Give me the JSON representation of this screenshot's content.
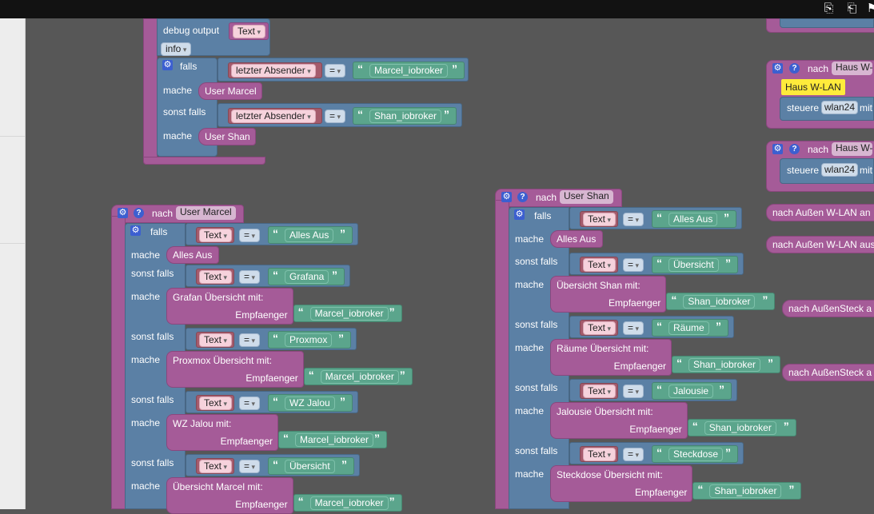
{
  "toolbar": {
    "icons": [
      "export-icon",
      "import-icon",
      "more-icon"
    ]
  },
  "top_block": {
    "debug_label": "debug output",
    "debug_arg": "Text",
    "debug_level": "info",
    "falls": "falls",
    "mache": "mache",
    "sonst_falls": "sonst falls",
    "cond1_var": "letzter Absender",
    "cond1_op": "=",
    "cond1_val": "Marcel_iobroker",
    "call1": "User Marcel",
    "cond2_var": "letzter Absender",
    "cond2_op": "=",
    "cond2_val": "Shan_iobroker",
    "call2": "User Shan"
  },
  "marcel": {
    "header_prefix": "nach",
    "header_name": "User Marcel",
    "rows": [
      {
        "kw": "falls",
        "var": "Text",
        "op": "=",
        "val": "Alles Aus",
        "mache": "mache",
        "call": "Alles Aus"
      },
      {
        "kw": "sonst falls",
        "var": "Text",
        "op": "=",
        "val": "Grafana",
        "mache": "mache",
        "call": "Grafan Übersicht mit:",
        "param": "Empfaenger",
        "param_val": "Marcel_iobroker"
      },
      {
        "kw": "sonst falls",
        "var": "Text",
        "op": "=",
        "val": "Proxmox",
        "mache": "mache",
        "call": "Proxmox Übersicht  mit:",
        "param": "Empfaenger",
        "param_val": "Marcel_iobroker"
      },
      {
        "kw": "sonst falls",
        "var": "Text",
        "op": "=",
        "val": "WZ Jalou",
        "mache": "mache",
        "call": "WZ Jalou  mit:",
        "param": "Empfaenger",
        "param_val": "Marcel_iobroker"
      },
      {
        "kw": "sonst falls",
        "var": "Text",
        "op": "=",
        "val": "Übersicht",
        "mache": "mache",
        "call": "Übersicht Marcel mit:",
        "param": "Empfaenger",
        "param_val": "Marcel_iobroker"
      }
    ]
  },
  "shan": {
    "header_prefix": "nach",
    "header_name": "User Shan",
    "rows": [
      {
        "kw": "falls",
        "var": "Text",
        "op": "=",
        "val": "Alles Aus",
        "mache": "mache",
        "call": "Alles Aus"
      },
      {
        "kw": "sonst falls",
        "var": "Text",
        "op": "=",
        "val": "Übersicht",
        "mache": "mache",
        "call": "Übersicht Shan mit:",
        "param": "Empfaenger",
        "param_val": "Shan_iobroker"
      },
      {
        "kw": "sonst falls",
        "var": "Text",
        "op": "=",
        "val": "Räume",
        "mache": "mache",
        "call": "Räume Übersicht mit:",
        "param": "Empfaenger",
        "param_val": "Shan_iobroker"
      },
      {
        "kw": "sonst falls",
        "var": "Text",
        "op": "=",
        "val": "Jalousie",
        "mache": "mache",
        "call": "Jalousie Übersicht mit:",
        "param": "Empfaenger",
        "param_val": "Shan_iobroker"
      },
      {
        "kw": "sonst falls",
        "var": "Text",
        "op": "=",
        "val": "Steckdose",
        "mache": "mache",
        "call": "Steckdose Übersicht mit:",
        "param": "Empfaenger",
        "param_val": "Shan_iobroker"
      }
    ]
  },
  "right": {
    "nach": "nach",
    "haus1_name": "Haus W-",
    "haus_label": "Haus W-LAN",
    "steuere": "steuere",
    "wlan": "wlan24",
    "mit": "mit",
    "haus2_name": "Haus W-",
    "aussen_an": "nach Außen W-LAN an",
    "aussen_aus": "nach Außen W-LAN aus",
    "steck1": "nach AußenSteck a",
    "steck2": "nach AußenSteck a"
  },
  "colors": {
    "workspace": "#575757",
    "procedure": "#a55b98",
    "logic": "#5b80a5",
    "text": "#5ba58c",
    "variable": "#a55b6c"
  }
}
